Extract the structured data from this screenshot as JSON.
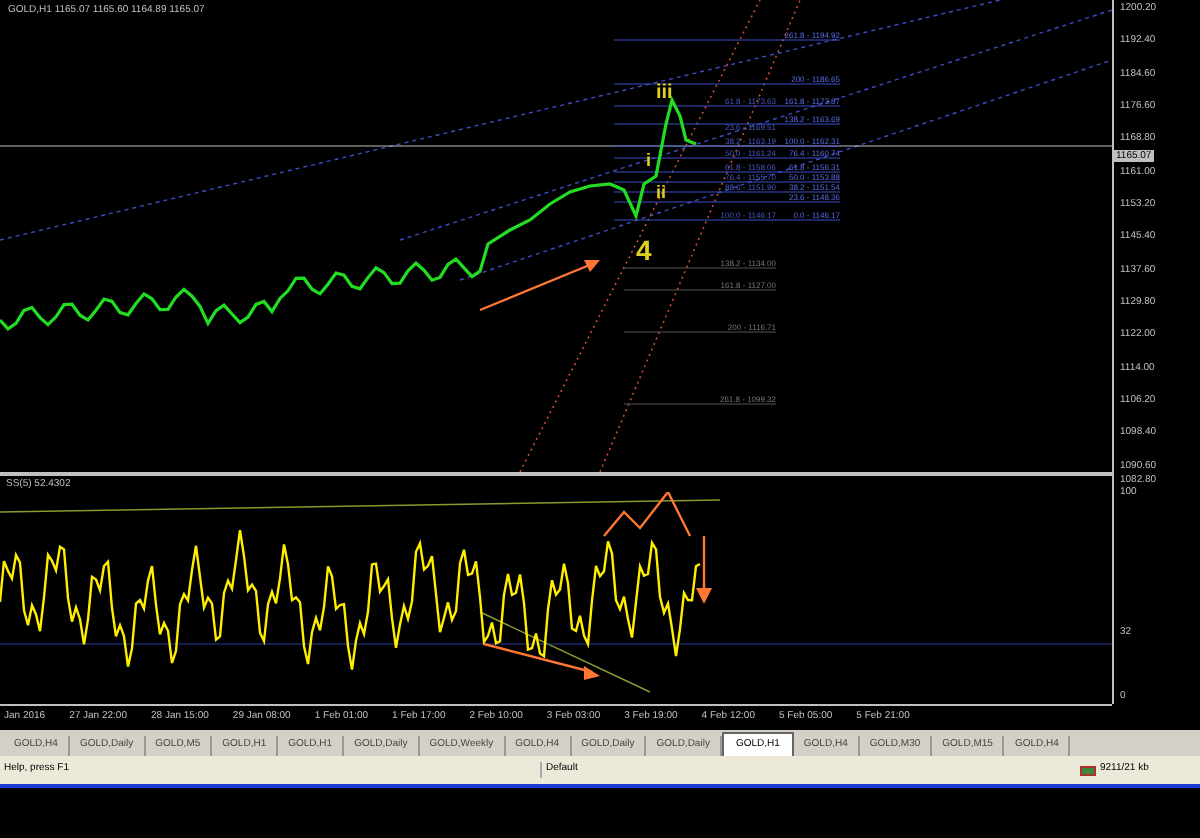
{
  "chart": {
    "header": "GOLD,H1  1165.07 1165.60 1164.89 1165.07",
    "price_axis": [
      "1200.20",
      "1192.40",
      "1184.60",
      "1176.60",
      "1168.80",
      "1161.00",
      "1153.20",
      "1145.40",
      "1137.60",
      "1129.80",
      "1122.00",
      "1114.00",
      "1106.20",
      "1098.40",
      "1090.60"
    ],
    "current_price": "1165.07",
    "fib_right": [
      "261.8 - 1194.92",
      "200 - 1186.65",
      "161.8 - 1173.87",
      "138.2 - 1163.69",
      "100.0 - 1162.31",
      "76.4 - 1160.74",
      "61.8 - 1156.31",
      "50.0 - 1153.88",
      "38.2 - 1151.54",
      "23.6 - 1148.36",
      "0.0 - 1146.17"
    ],
    "fib_middle": [
      "61.8 - 1173.63",
      "23.6 - 1169.51",
      "38.2 - 1163.19",
      "50.0 - 1161.24",
      "61.8 - 1158.06",
      "76.4 - 1155.70",
      "88.6 - 1151.90",
      "100.0 - 1146.17"
    ],
    "fib_lower": [
      "138.2 - 1134.00",
      "161.8 - 1127.00",
      "200 - 1116.71",
      "261.8 - 1099.32"
    ],
    "wave_labels": [
      "iii",
      "i",
      "ii",
      "4"
    ]
  },
  "indicator": {
    "label": "SS(5) 52.4302",
    "axis": [
      "1082.80",
      "100",
      "32",
      "0"
    ]
  },
  "time_axis": [
    "Jan 2016",
    "27 Jan 22:00",
    "28 Jan 15:00",
    "29 Jan 08:00",
    "1 Feb 01:00",
    "1 Feb 17:00",
    "2 Feb 10:00",
    "3 Feb 03:00",
    "3 Feb 19:00",
    "4 Feb 12:00",
    "5 Feb 05:00",
    "5 Feb 21:00"
  ],
  "tabs": [
    {
      "label": "GOLD,H4",
      "selected": false
    },
    {
      "label": "GOLD,Daily",
      "selected": false
    },
    {
      "label": "GOLD,M5",
      "selected": false
    },
    {
      "label": "GOLD,H1",
      "selected": false
    },
    {
      "label": "GOLD,H1",
      "selected": false
    },
    {
      "label": "GOLD,Daily",
      "selected": false
    },
    {
      "label": "GOLD,Weekly",
      "selected": false
    },
    {
      "label": "GOLD,H4",
      "selected": false
    },
    {
      "label": "GOLD,Daily",
      "selected": false
    },
    {
      "label": "GOLD,Daily",
      "selected": false
    },
    {
      "label": "GOLD,H1",
      "selected": true
    },
    {
      "label": "GOLD,H4",
      "selected": false
    },
    {
      "label": "GOLD,M30",
      "selected": false
    },
    {
      "label": "GOLD,M15",
      "selected": false
    },
    {
      "label": "GOLD,H4",
      "selected": false
    }
  ],
  "status_bar": {
    "help": "Help, press F1",
    "profile": "Default",
    "traffic": "9211/21 kb"
  }
}
